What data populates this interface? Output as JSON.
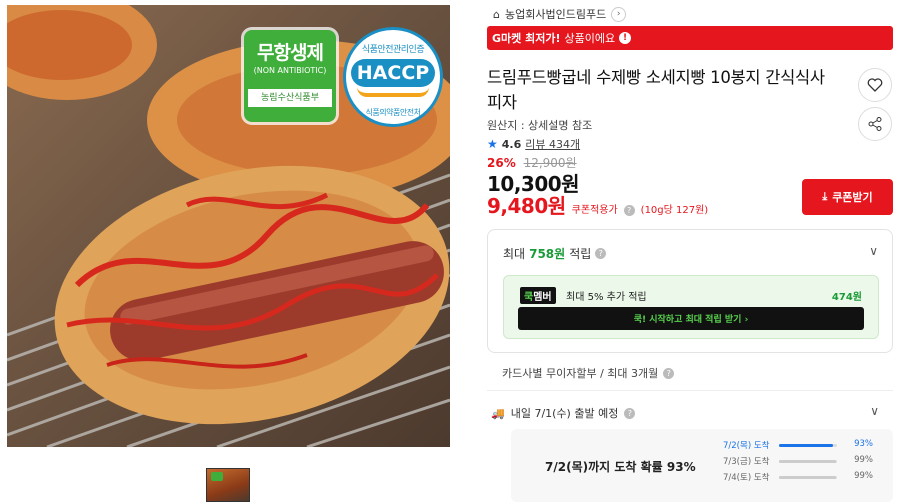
{
  "image": {
    "badge_green": {
      "title": "무항생제",
      "subtitle": "(NON ANTIBIOTIC)",
      "footer": "농림수산식품부"
    },
    "badge_haccp": {
      "top": "식품안전관리인증",
      "title": "HACCP",
      "footer": "식품의약품안전처"
    }
  },
  "seller": {
    "name": "농업회사법인드림푸드"
  },
  "banner": {
    "highlight": "G마켓 최저가!",
    "text": "상품이에요"
  },
  "product": {
    "title": "드림푸드빵굽네 수제빵 소세지빵 10봉지 간식식사피자",
    "origin": "원산지 : 상세설명 참조",
    "rating": "4.6",
    "reviews": "리뷰 434개"
  },
  "price": {
    "discount_rate": "26%",
    "original": "12,900원",
    "sale": "10,300원",
    "coupon_price": "9,480원",
    "coupon_label": "쿠폰적용가",
    "unit": "(10g당 127원)",
    "coupon_button": "쿠폰받기"
  },
  "points": {
    "prefix": "최대",
    "amount": "758원",
    "suffix": "적립",
    "member_tag_a": "쿡",
    "member_tag_b": "멤버",
    "member_text": "최대 5% 추가 적립",
    "member_amount": "474원",
    "member_button": "쿡! 시작하고 최대 적립 받기 ›"
  },
  "card": {
    "text": "카드사별 무이자할부 / 최대 3개월"
  },
  "shipping": {
    "text": "내일 7/1(수) 출발 예정",
    "arrival_main": "7/2(목)까지 도착 확률 93%",
    "rows": [
      {
        "date": "7/2(목) 도착",
        "pct": "93%",
        "value": 0.93
      },
      {
        "date": "7/3(금) 도착",
        "pct": "99%",
        "value": 0.99
      },
      {
        "date": "7/4(토) 도착",
        "pct": "99%",
        "value": 0.99
      }
    ]
  },
  "colors": {
    "accent": "#e5161d",
    "points_green": "#1a9b37",
    "member_green": "#58d34e",
    "link_blue": "#1a73e8"
  }
}
